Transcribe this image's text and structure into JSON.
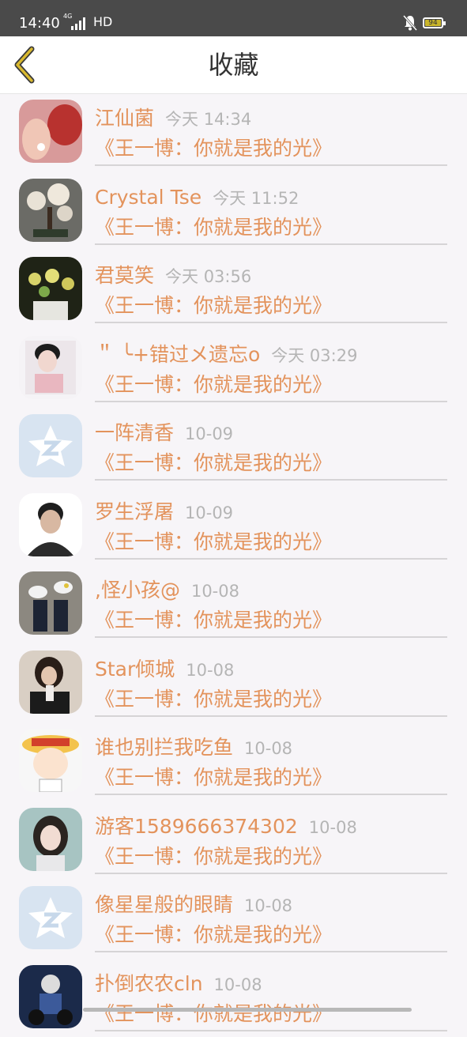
{
  "status_bar": {
    "time": "14:40",
    "network_type": "4G",
    "hd": "HD",
    "battery": "94",
    "battery_color": "#c9b52a"
  },
  "header": {
    "title": "收藏",
    "back_icon": "chevron-left-icon",
    "back_color": "#c9a92a"
  },
  "colors": {
    "accent": "#e3935c",
    "muted": "#b5b5b5"
  },
  "favorites": [
    {
      "name": "江仙菌",
      "time": "今天 14:34",
      "book": "《王一博：你就是我的光》",
      "avatar": "rose-photo"
    },
    {
      "name": "Crystal Tse",
      "time": "今天 11:52",
      "book": "《王一博：你就是我的光》",
      "avatar": "bonsai-photo"
    },
    {
      "name": "君莫笑",
      "time": "今天 03:56",
      "book": "《王一博：你就是我的光》",
      "avatar": "flowers-photo"
    },
    {
      "name": "＂ ╰+错过メ遗忘o",
      "time": "今天 03:29",
      "book": "《王一博：你就是我的光》",
      "avatar": "girl-photo"
    },
    {
      "name": "一阵清香",
      "time": "10-09",
      "book": "《王一博：你就是我的光》",
      "avatar": "qzone-default-icon"
    },
    {
      "name": "罗生浮屠",
      "time": "10-09",
      "book": "《王一博：你就是我的光》",
      "avatar": "man-photo"
    },
    {
      "name": ",怪小孩@",
      "time": "10-08",
      "book": "《王一博：你就是我的光》",
      "avatar": "shoes-photo"
    },
    {
      "name": "Star倾城",
      "time": "10-08",
      "book": "《王一博：你就是我的光》",
      "avatar": "selfie-photo"
    },
    {
      "name": "谁也别拦我吃鱼",
      "time": "10-08",
      "book": "《王一博：你就是我的光》",
      "avatar": "anime-straw-hat-photo"
    },
    {
      "name": "游客1589666374302",
      "time": "10-08",
      "book": "《王一博：你就是我的光》",
      "avatar": "woman-portrait-photo"
    },
    {
      "name": "像星星般的眼睛",
      "time": "10-08",
      "book": "《王一博：你就是我的光》",
      "avatar": "qzone-default-icon"
    },
    {
      "name": "扑倒农农cln",
      "time": "10-08",
      "book": "《王一博：你就是我的光》",
      "avatar": "motorbike-photo"
    }
  ]
}
